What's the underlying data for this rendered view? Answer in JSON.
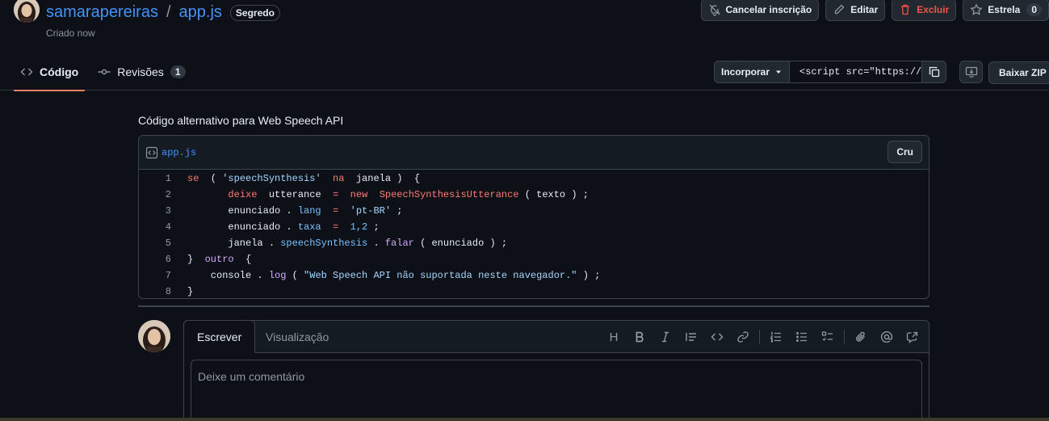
{
  "header": {
    "owner": "samarapereiras",
    "separator": "/",
    "filename": "app.js",
    "visibility_badge": "Segredo",
    "created": "Criado now"
  },
  "actions": {
    "unsubscribe": "Cancelar inscrição",
    "edit": "Editar",
    "delete": "Excluir",
    "star": "Estrela",
    "star_count": "0"
  },
  "tabs": {
    "code": "Código",
    "revisions": "Revisões",
    "revisions_count": "1"
  },
  "embed": {
    "select_label": "Incorporar",
    "value": "<script src=\"https://g",
    "download_zip": "Baixar ZIP"
  },
  "gist": {
    "description": "Código alternativo para Web Speech API",
    "file_name": "app.js",
    "raw_label": "Cru",
    "line_numbers": [
      "1",
      "2",
      "3",
      "4",
      "5",
      "6",
      "7",
      "8"
    ]
  },
  "comment": {
    "write_tab": "Escrever",
    "preview_tab": "Visualização",
    "placeholder": "Deixe um comentário",
    "heading_tool": "H"
  },
  "colors": {
    "background": "#0d1117",
    "link": "#4493f8",
    "danger": "#f85149",
    "keyword": "#ff7b72",
    "string": "#a5d6ff",
    "function": "#d2a8ff",
    "constant": "#79c0ff",
    "tab_underline": "#f78166"
  }
}
